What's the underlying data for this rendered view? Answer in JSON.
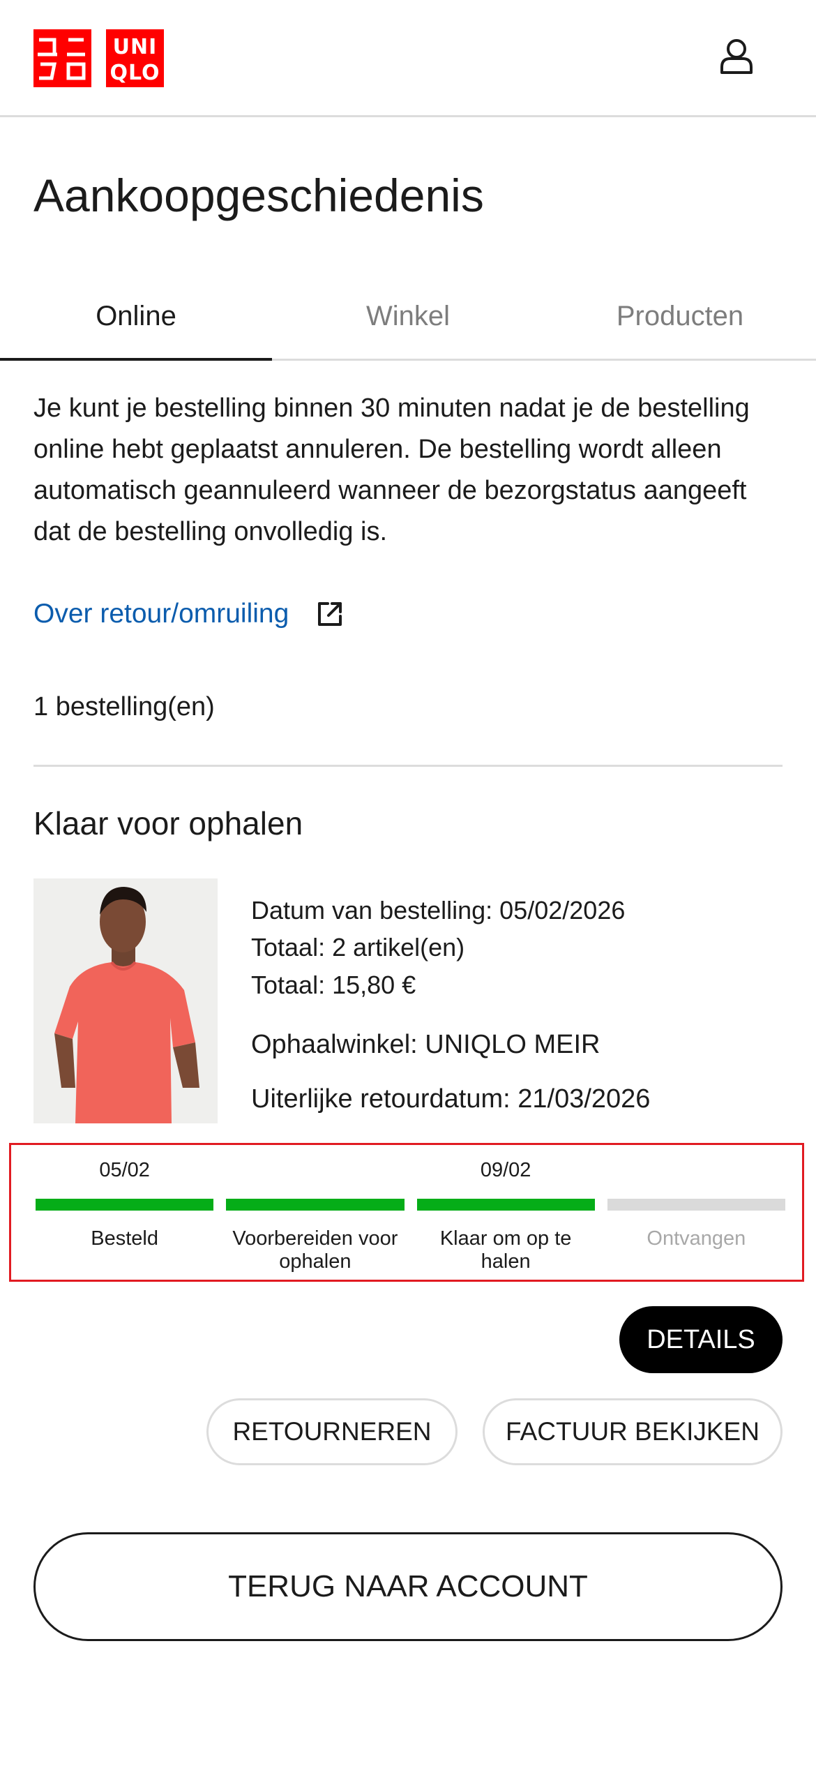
{
  "header": {
    "logo": {
      "left_block_glyph": "ユニクロ",
      "right_block_lines": [
        "UNI",
        "QLO"
      ],
      "brand_color": "#ff0000"
    },
    "account_icon": "user-icon"
  },
  "page": {
    "title": "Aankoopgeschiedenis"
  },
  "tabs": [
    {
      "label": "Online",
      "active": true
    },
    {
      "label": "Winkel",
      "active": false
    },
    {
      "label": "Producten",
      "active": false
    }
  ],
  "info_text": "Je kunt je bestelling binnen 30 minuten nadat je de bestelling online hebt geplaatst annuleren. De bestelling wordt alleen automatisch geannuleerd wanneer de bezorgstatus aangeeft dat de bestelling onvolledig is.",
  "return_link": {
    "label": "Over retour/omruiling",
    "icon": "external-link-icon"
  },
  "order_count": "1 bestelling(en)",
  "order": {
    "status": "Klaar voor ophalen",
    "image_icon": "product-photo-red-tshirt",
    "order_date": "Datum van bestelling: 05/02/2026",
    "total_items": "Totaal: 2 artikel(en)",
    "total_price": "Totaal: 15,80 €",
    "pickup_store": "Ophaalwinkel: UNIQLO MEIR",
    "return_deadline": "Uiterlijke retourdatum: 21/03/2026",
    "progress": [
      {
        "date": "05/02",
        "label": "Besteld",
        "completed": true
      },
      {
        "date": "",
        "label": "Voorbereiden voor ophalen",
        "completed": true
      },
      {
        "date": "09/02",
        "label": "Klaar om op te halen",
        "completed": true
      },
      {
        "date": "",
        "label": "Ontvangen",
        "completed": false
      }
    ],
    "colors": {
      "progress_done": "#05ad18",
      "progress_pending": "#dadada",
      "highlight_border": "#e11b22",
      "link": "#0b5cad"
    }
  },
  "buttons": {
    "details": "DETAILS",
    "return": "RETOURNEREN",
    "invoice": "FACTUUR BEKIJKEN",
    "back_to_account": "TERUG NAAR ACCOUNT"
  }
}
